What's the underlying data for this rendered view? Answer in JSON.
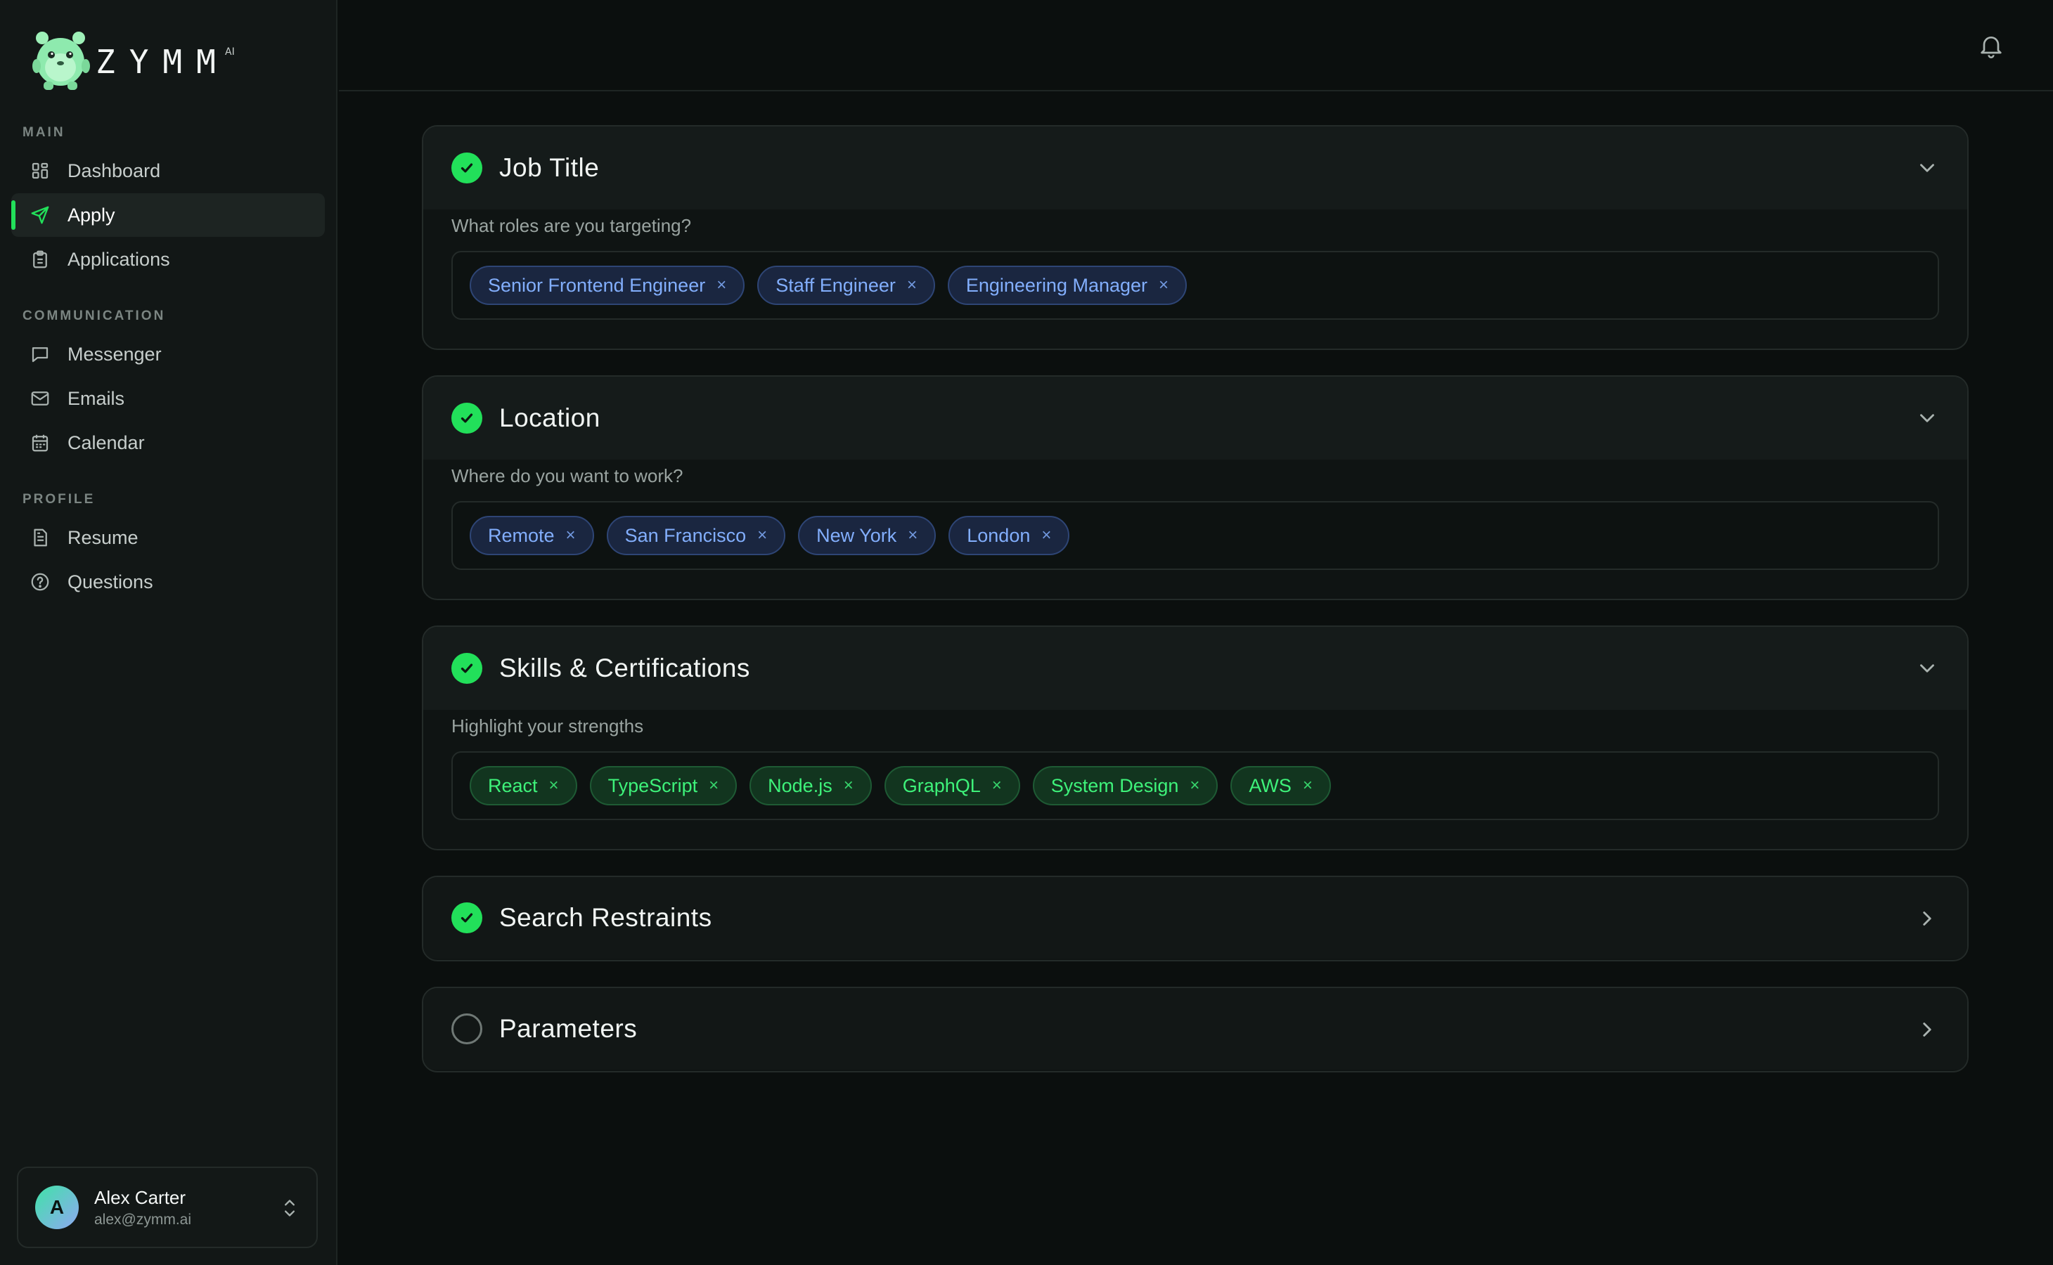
{
  "brand": {
    "name": "ZYMM",
    "suffix": "AI"
  },
  "nav": {
    "sections": [
      {
        "label": "MAIN",
        "items": [
          {
            "label": "Dashboard",
            "icon": "grid-icon"
          },
          {
            "label": "Apply",
            "icon": "send-icon",
            "active": true
          },
          {
            "label": "Applications",
            "icon": "clipboard-icon"
          }
        ]
      },
      {
        "label": "COMMUNICATION",
        "items": [
          {
            "label": "Messenger",
            "icon": "chat-icon"
          },
          {
            "label": "Emails",
            "icon": "mail-icon"
          },
          {
            "label": "Calendar",
            "icon": "calendar-icon"
          }
        ]
      },
      {
        "label": "PROFILE",
        "items": [
          {
            "label": "Resume",
            "icon": "document-icon"
          },
          {
            "label": "Questions",
            "icon": "help-circle-icon"
          }
        ]
      }
    ]
  },
  "user": {
    "initial": "A",
    "name": "Alex Carter",
    "email": "alex@zymm.ai"
  },
  "cards": [
    {
      "title": "Job Title",
      "subtitle": "What roles are you targeting?",
      "complete": true,
      "expanded": true,
      "tags": [
        "Senior Frontend Engineer",
        "Staff Engineer",
        "Engineering Manager"
      ],
      "tag_color": "blue"
    },
    {
      "title": "Location",
      "subtitle": "Where do you want to work?",
      "complete": true,
      "expanded": true,
      "tags": [
        "Remote",
        "San Francisco",
        "New York",
        "London"
      ],
      "tag_color": "blue"
    },
    {
      "title": "Skills & Certifications",
      "subtitle": "Highlight your strengths",
      "complete": true,
      "expanded": true,
      "tags": [
        "React",
        "TypeScript",
        "Node.js",
        "GraphQL",
        "System Design",
        "AWS"
      ],
      "tag_color": "green"
    },
    {
      "title": "Search Restraints",
      "complete": true,
      "expanded": false
    },
    {
      "title": "Parameters",
      "complete": false,
      "expanded": false
    }
  ],
  "colors": {
    "accent": "#22e05a",
    "tag_blue": "#82aefc",
    "tag_green": "#3ef27a"
  },
  "tag_remove_glyph": "×"
}
